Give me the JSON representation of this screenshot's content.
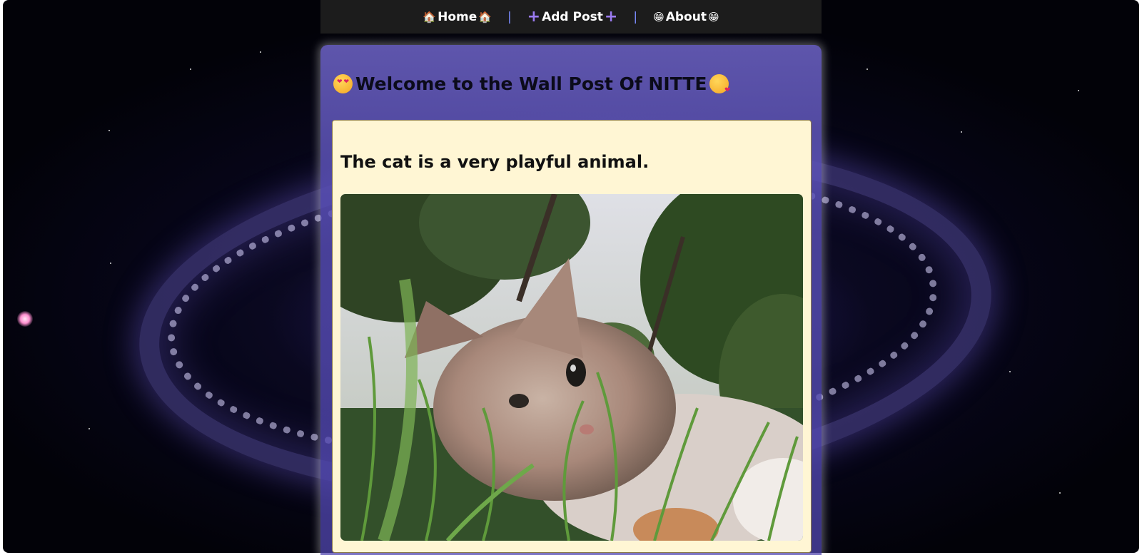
{
  "nav": {
    "items": [
      {
        "label": "Home",
        "icon": "house-icon"
      },
      {
        "label": "Add Post",
        "icon": "plus-icon"
      },
      {
        "label": "About",
        "icon": "grinning-face-icon"
      }
    ],
    "separator": "|"
  },
  "page": {
    "title": "Welcome to the Wall Post Of NITTE",
    "title_icons": [
      "heart-eyes-emoji-icon",
      "kissing-face-emoji-icon"
    ]
  },
  "post": {
    "title": "The cat is a very playful animal.",
    "image": "cat-in-grass-photo"
  },
  "colors": {
    "navbar": "#1c1c1c",
    "nav_separator": "#7b8cff",
    "post_card_bg": "#fff6d4",
    "panel_purple": "#6e64c8"
  }
}
